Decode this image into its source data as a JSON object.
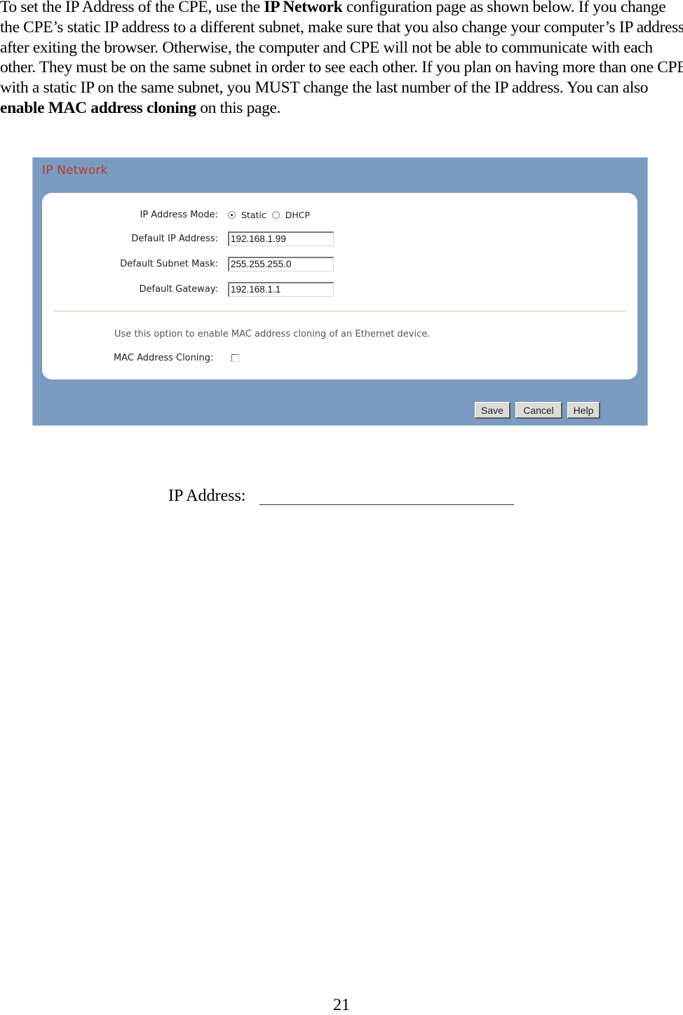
{
  "intro": {
    "p1": "To set the IP Address of the CPE, use the ",
    "b1": "IP Network",
    "p2": " configuration page as shown below.  If you change the CPE’s static IP address to a different subnet, make sure that you also change your computer’s IP address after exiting the browser.  Otherwise, the computer and CPE will not be able to communicate with each other.  They must be on the same subnet in order to see each other.  If you plan on having more than one CPE with a static IP on the same subnet, you MUST change the last number of the IP address. You can also ",
    "b2": "enable MAC address cloning",
    "p3": " on this page."
  },
  "panel": {
    "title": "IP Network",
    "title_color": "#c0392b",
    "bg_color": "#7b9abf",
    "mode": {
      "label": "IP Address Mode:",
      "options": [
        {
          "label": "Static",
          "selected": true
        },
        {
          "label": "DHCP",
          "selected": false
        }
      ]
    },
    "fields": [
      {
        "label": "Default IP Address:",
        "value": "192.168.1.99"
      },
      {
        "label": "Default Subnet Mask:",
        "value": "255.255.255.0"
      },
      {
        "label": "Default Gateway:",
        "value": "192.168.1.1"
      }
    ],
    "mac_hint": "Use this option to enable MAC address cloning of an Ethernet device.",
    "mac_label": "MAC Address Cloning:",
    "mac_checked": false,
    "buttons": {
      "save": "Save",
      "cancel": "Cancel",
      "help": "Help"
    }
  },
  "worksheet": {
    "ip_label": "IP Address:"
  },
  "page_number": "21"
}
